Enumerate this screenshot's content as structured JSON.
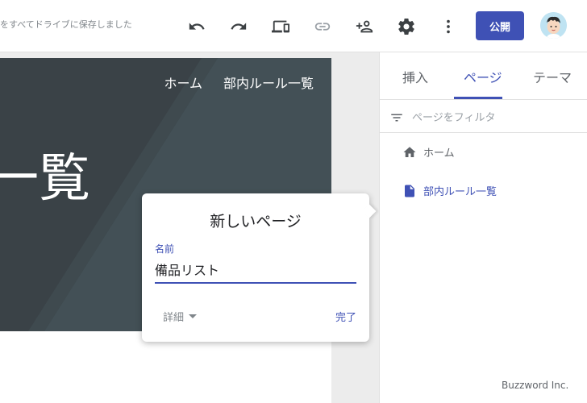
{
  "toolbar": {
    "save_status": "をすべてドライブに保存しました",
    "undo_icon": "undo-icon",
    "redo_icon": "redo-icon",
    "preview_icon": "devices-preview-icon",
    "link_icon": "link-icon",
    "share_icon": "person-add-icon",
    "settings_icon": "gear-icon",
    "more_icon": "more-vert-icon",
    "publish_label": "公開",
    "accent_color": "#3f51b5"
  },
  "site": {
    "nav": [
      "ホーム",
      "部内ルール一覧"
    ],
    "hero_title": "ー一覧",
    "hero_color": "#3a4247"
  },
  "popup": {
    "title": "新しいページ",
    "name_label": "名前",
    "name_value": "備品リスト",
    "details_label": "詳細",
    "done_label": "完了"
  },
  "panel": {
    "tabs": [
      "挿入",
      "ページ",
      "テーマ"
    ],
    "active_tab": "ページ",
    "filter_placeholder": "ページをフィルタ",
    "pages": [
      {
        "label": "ホーム",
        "icon": "home-icon"
      },
      {
        "label": "部内ルール一覧",
        "icon": "document-icon"
      }
    ]
  },
  "watermark": "Buzzword Inc."
}
